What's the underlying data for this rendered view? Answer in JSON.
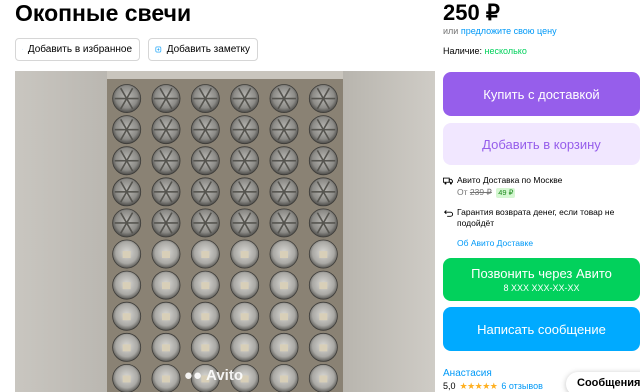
{
  "listing": {
    "title": "Окопные свечи",
    "add_favorite_label": "Добавить в избранное",
    "add_note_label": "Добавить заметку"
  },
  "price": {
    "value": "250 ₽",
    "or_text": "или",
    "offer_link": "предложите свою цену",
    "availability_label": "Наличие:",
    "availability_value": "несколько"
  },
  "buttons": {
    "buy_delivery": "Купить с доставкой",
    "add_to_cart": "Добавить в корзину",
    "call": "Позвонить через Авито",
    "phone": "8 XXX XXX-XX-XX",
    "message": "Написать сообщение"
  },
  "delivery": {
    "title": "Авито Доставка по Москве",
    "from_label": "От",
    "old_price": "239 ₽",
    "new_price": "49 ₽",
    "guarantee": "Гарантия возврата денег, если товар не подойдёт",
    "about_link": "Об Авито Доставке"
  },
  "seller": {
    "name": "Анастасия",
    "rating": "5,0",
    "stars": "★★★★★",
    "reviews": "6 отзывов"
  },
  "gallery": {
    "watermark": "Avito"
  },
  "chat": {
    "label": "Сообщения"
  },
  "colors": {
    "purple": "#965eeb",
    "light_purple": "#f1e7ff",
    "green": "#02d15c",
    "blue": "#00aaff",
    "link": "#0099f7"
  },
  "icons": [
    "heart-icon",
    "note-icon",
    "truck-icon",
    "refund-icon",
    "star-icon"
  ]
}
